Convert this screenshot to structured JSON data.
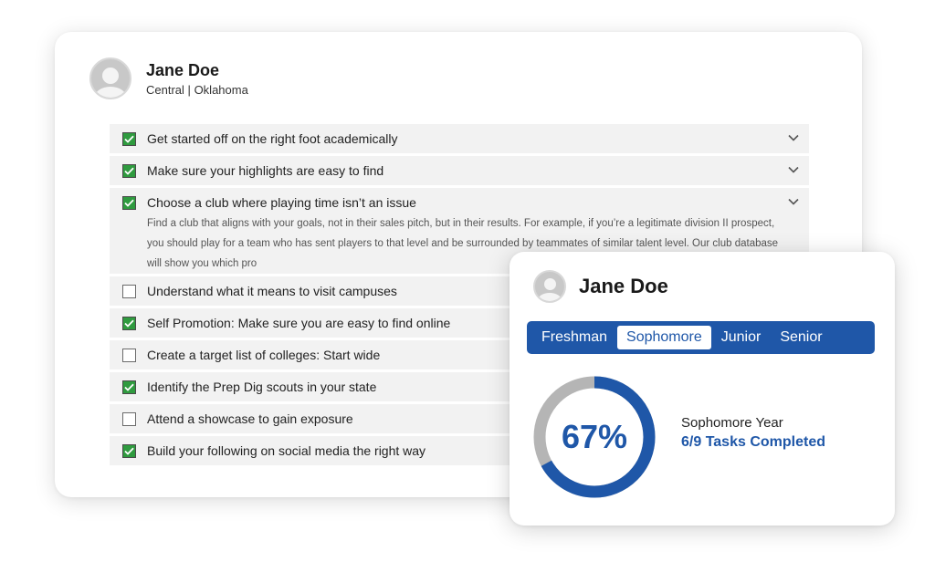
{
  "profile": {
    "name": "Jane Doe",
    "school": "Central",
    "separator": "|",
    "state": "Oklahoma"
  },
  "checklist": [
    {
      "label": "Get started off on the right foot academically",
      "checked": true
    },
    {
      "label": "Make sure your highlights are easy to find",
      "checked": true
    },
    {
      "label": "Choose a club where playing time isn’t an issue",
      "checked": true,
      "expanded": true,
      "detail": "Find a club that aligns with your goals, not in their sales pitch, but in their results. For example, if you’re a legitimate division II prospect, you should play for a team who has sent players to that level and be surrounded by teammates of similar talent level. Our club database will show you which pro"
    },
    {
      "label": "Understand what it means to visit campuses",
      "checked": false
    },
    {
      "label": "Self Promotion: Make sure you are easy to find online",
      "checked": true
    },
    {
      "label": "Create a target list of colleges: Start wide",
      "checked": false
    },
    {
      "label": "Identify the Prep Dig scouts in your state",
      "checked": true
    },
    {
      "label": "Attend a showcase to gain exposure",
      "checked": false
    },
    {
      "label": "Build your following on social media the right way",
      "checked": true
    }
  ],
  "progress_card": {
    "name": "Jane Doe",
    "tabs": [
      "Freshman",
      "Sophomore",
      "Junior",
      "Senior"
    ],
    "active_tab": "Sophomore",
    "percent_label": "67%",
    "percent_value": 0.67,
    "year_label": "Sophomore Year",
    "tasks_label": "6/9 Tasks Completed"
  },
  "icons": {
    "checkbox": "checkbox-icon",
    "chevron": "chevron-down-icon",
    "avatar": "user-avatar-icon"
  },
  "colors": {
    "accent_blue": "#1f57a8",
    "check_green": "#2f9b3f",
    "ring_track": "#b5b5b5",
    "row_background": "#f2f2f2"
  }
}
